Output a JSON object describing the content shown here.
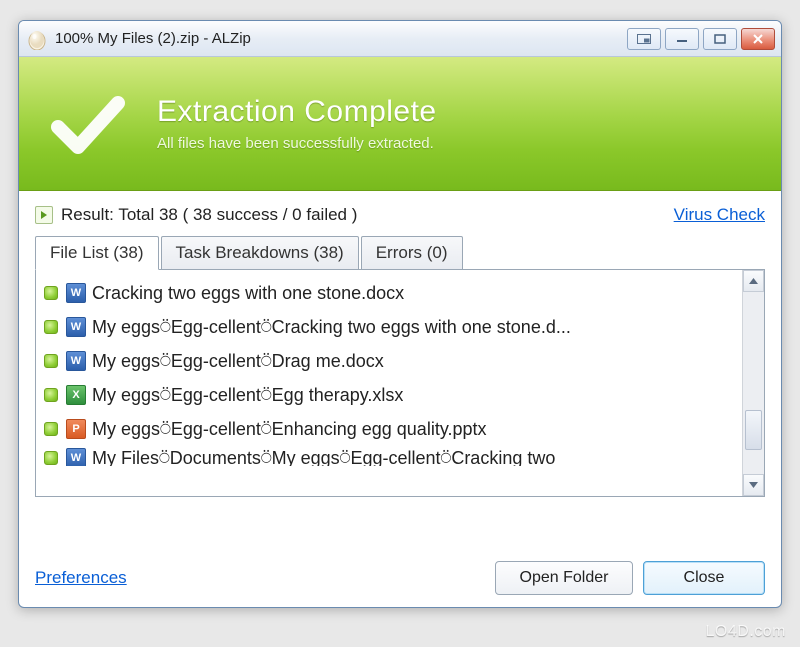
{
  "window": {
    "title": "100% My Files (2).zip - ALZip"
  },
  "banner": {
    "heading": "Extraction Complete",
    "subtext": "All files have been successfully extracted."
  },
  "result": {
    "text": "Result: Total 38 ( 38 success / 0 failed )",
    "virus_check": "Virus Check"
  },
  "tabs": {
    "file_list": "File List (38)",
    "task_breakdowns": "Task Breakdowns (38)",
    "errors": "Errors (0)"
  },
  "files": [
    {
      "type": "doc",
      "name": "Cracking two eggs with one stone.docx"
    },
    {
      "type": "doc",
      "name": "My eggs⍥Egg-cellent⍥Cracking two eggs with one stone.d..."
    },
    {
      "type": "doc",
      "name": "My eggs⍥Egg-cellent⍥Drag me.docx"
    },
    {
      "type": "xls",
      "name": "My eggs⍥Egg-cellent⍥Egg therapy.xlsx"
    },
    {
      "type": "ppt",
      "name": "My eggs⍥Egg-cellent⍥Enhancing egg quality.pptx"
    },
    {
      "type": "doc",
      "name": "My Files⍥Documents⍥My eggs⍥Egg-cellent⍥Cracking two"
    }
  ],
  "footer": {
    "preferences": "Preferences",
    "open_folder": "Open Folder",
    "close": "Close"
  },
  "watermark": "LO4D.com"
}
